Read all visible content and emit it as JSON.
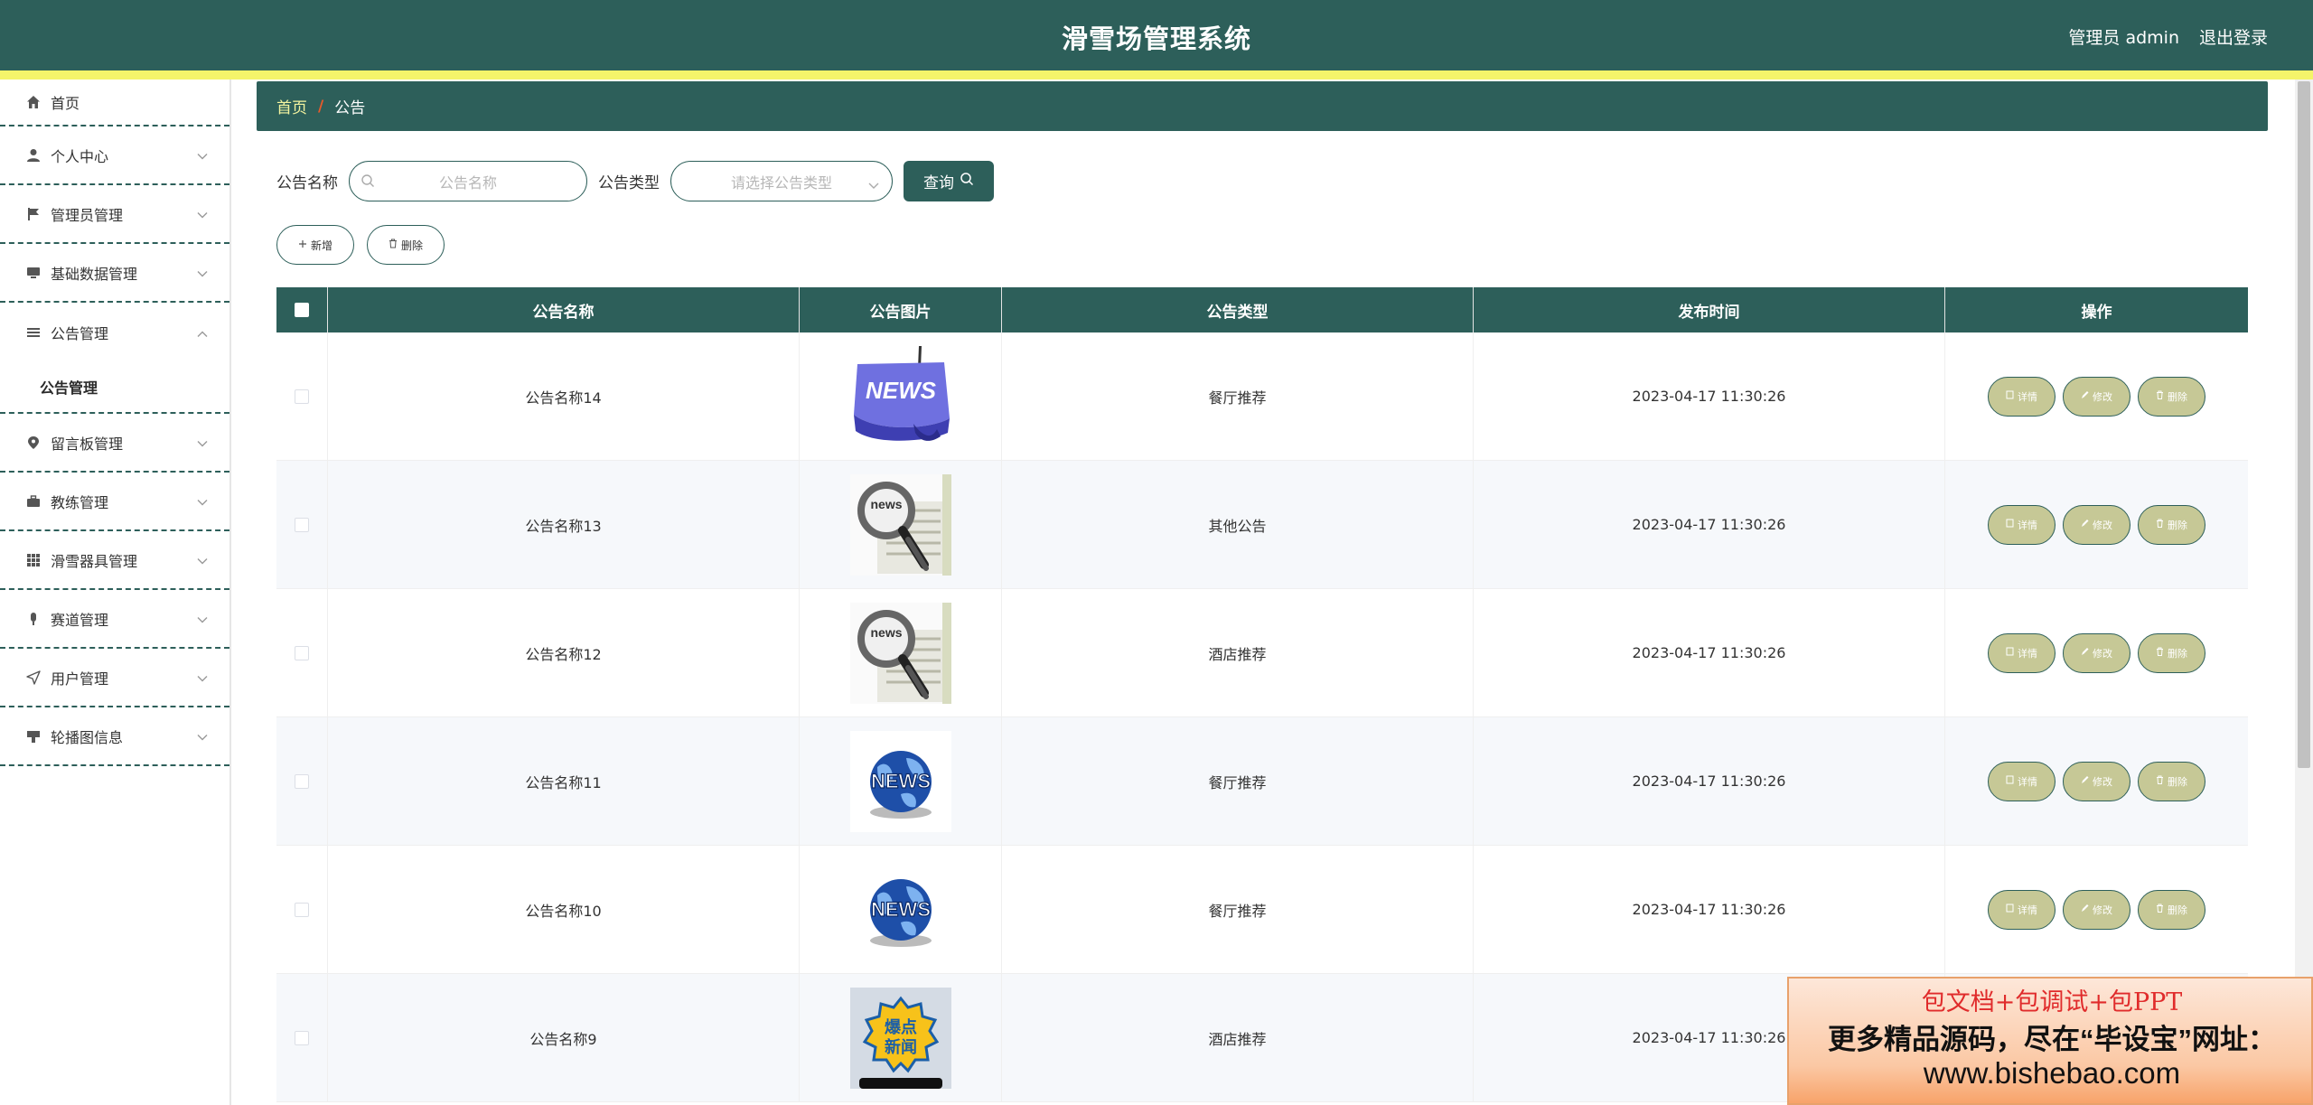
{
  "header": {
    "title": "滑雪场管理系统",
    "user": "管理员 admin",
    "logout": "退出登录"
  },
  "sidebar": {
    "items": [
      {
        "label": "首页",
        "icon": "home-icon"
      },
      {
        "label": "个人中心",
        "icon": "user-icon"
      },
      {
        "label": "管理员管理",
        "icon": "flag-icon"
      },
      {
        "label": "基础数据管理",
        "icon": "monitor-icon"
      },
      {
        "label": "公告管理",
        "icon": "menu-icon",
        "sub": "公告管理"
      },
      {
        "label": "留言板管理",
        "icon": "location-icon"
      },
      {
        "label": "教练管理",
        "icon": "briefcase-icon"
      },
      {
        "label": "滑雪器具管理",
        "icon": "grid-icon"
      },
      {
        "label": "赛道管理",
        "icon": "microphone-icon"
      },
      {
        "label": "用户管理",
        "icon": "send-icon"
      },
      {
        "label": "轮播图信息",
        "icon": "stamp-icon"
      }
    ]
  },
  "breadcrumb": {
    "home": "首页",
    "sep": "/",
    "current": "公告"
  },
  "search": {
    "name_label": "公告名称",
    "name_placeholder": "公告名称",
    "type_label": "公告类型",
    "type_placeholder": "请选择公告类型",
    "query_label": "查询"
  },
  "actions": {
    "add": "新增",
    "delete": "删除"
  },
  "table": {
    "headers": {
      "name": "公告名称",
      "pic": "公告图片",
      "type": "公告类型",
      "time": "发布时间",
      "op": "操作"
    },
    "ops": {
      "detail": "详情",
      "edit": "修改",
      "delete": "删除"
    },
    "rows": [
      {
        "name": "公告名称14",
        "type": "餐厅推荐",
        "time": "2023-04-17 11:30:26",
        "pic": "news-keyboard"
      },
      {
        "name": "公告名称13",
        "type": "其他公告",
        "time": "2023-04-17 11:30:26",
        "pic": "news-magnifier"
      },
      {
        "name": "公告名称12",
        "type": "酒店推荐",
        "time": "2023-04-17 11:30:26",
        "pic": "news-magnifier"
      },
      {
        "name": "公告名称11",
        "type": "餐厅推荐",
        "time": "2023-04-17 11:30:26",
        "pic": "news-globe"
      },
      {
        "name": "公告名称10",
        "type": "餐厅推荐",
        "time": "2023-04-17 11:30:26",
        "pic": "news-globe"
      },
      {
        "name": "公告名称9",
        "type": "酒店推荐",
        "time": "2023-04-17 11:30:26",
        "pic": "breaking-news"
      }
    ]
  },
  "ad": {
    "line1": "包文档+包调试+包PPT",
    "line2": "更多精品源码，尽在“毕设宝”网址：",
    "line3": "www.bishebao.com"
  },
  "colors": {
    "primary": "#2d5f5a",
    "accent": "#f4f46a",
    "op_button": "#c6c896"
  }
}
